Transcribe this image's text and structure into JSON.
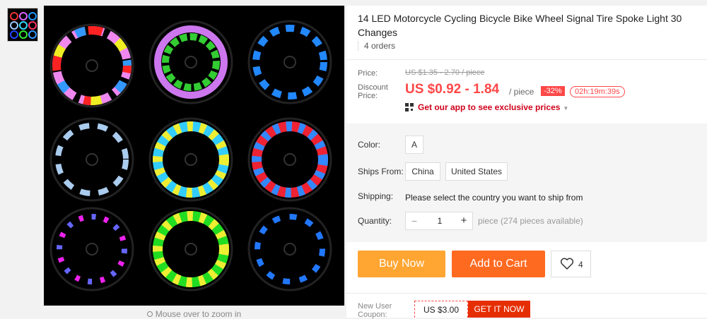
{
  "gallery": {
    "zoom_hint": "Mouse over to zoom in"
  },
  "product": {
    "title": "14 LED Motorcycle Cycling Bicycle Bike Wheel Signal Tire Spoke Light 30 Changes",
    "orders": "4 orders"
  },
  "pricing": {
    "price_label": "Price:",
    "original_price": "US $1.35 - 2.70 / piece",
    "discount_label_1": "Discount",
    "discount_label_2": "Price:",
    "discount_price": "US $0.92 - 1.84",
    "per_piece": "/ piece",
    "discount_badge": "-32%",
    "timer": "02h:19m:39s",
    "app_link": "Get our app to see exclusive prices"
  },
  "properties": {
    "color_label": "Color:",
    "color_option": "A",
    "ships_from_label": "Ships From:",
    "ships_from_options": [
      "China",
      "United States"
    ],
    "shipping_label": "Shipping:",
    "shipping_text": "Please select the country you want to ship from",
    "quantity_label": "Quantity:",
    "quantity_minus": "−",
    "quantity_value": "1",
    "quantity_plus": "+",
    "availability": "piece (274 pieces available)"
  },
  "actions": {
    "buy_now": "Buy Now",
    "add_to_cart": "Add to Cart",
    "wishlist_count": "4"
  },
  "coupon": {
    "label_1": "New User",
    "label_2": "Coupon:",
    "amount": "US $3.00",
    "get_it": "GET IT NOW"
  },
  "colors": {
    "accent_red": "#ff4747",
    "buy_orange": "#ffa532",
    "cart_orange": "#ff6a21"
  },
  "icons": [
    "qr-code-icon",
    "chevron-down-icon",
    "heart-icon",
    "magnifier-icon"
  ]
}
